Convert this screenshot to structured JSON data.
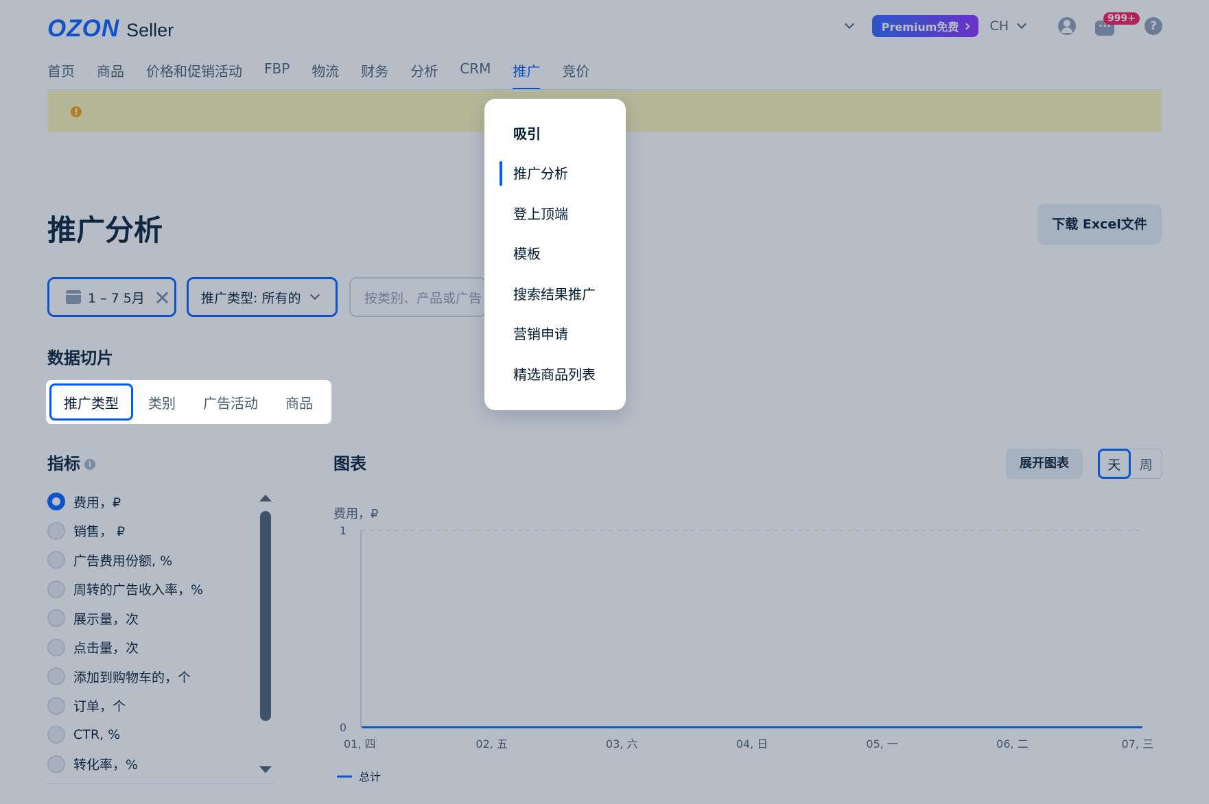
{
  "header": {
    "logo_main": "OZON",
    "logo_sub": "Seller",
    "premium_label": "Premium免费",
    "language": "CH",
    "notifications_badge": "999+",
    "help_label": "?"
  },
  "nav": {
    "items": [
      "首页",
      "商品",
      "价格和促销活动",
      "FBP",
      "物流",
      "财务",
      "分析",
      "CRM",
      "推广",
      "竞价"
    ],
    "active": "推广"
  },
  "banner": {
    "icon": "warning-icon"
  },
  "page": {
    "title": "推广分析",
    "excel_button": "下载 Excel文件"
  },
  "filters": {
    "date_range": "1 – 7 5月",
    "promotion_type": "推广类型: 所有的",
    "search_placeholder": "按类别、产品或广告"
  },
  "slice": {
    "heading": "数据切片",
    "tabs": [
      "推广类型",
      "类别",
      "广告活动",
      "商品"
    ],
    "active_tab": "推广类型"
  },
  "metrics": {
    "heading": "指标",
    "info_label": "i",
    "items": [
      "费用，₽",
      "销售， ₽",
      "广告费用份额, %",
      "周转的广告收入率，%",
      "展示量，次",
      "点击量，次",
      "添加到购物车的，个",
      "订单，个",
      "CTR, %",
      "转化率，%"
    ],
    "selected": "费用，₽"
  },
  "chart_section": {
    "heading": "图表",
    "expand_button": "展开图表",
    "granularity": [
      "天",
      "周"
    ],
    "active_granularity": "天"
  },
  "chart_data": {
    "type": "line",
    "ylabel": "费用，₽",
    "ylim": [
      0,
      1
    ],
    "yticks": [
      "1",
      "0"
    ],
    "categories": [
      "01, 四",
      "02, 五",
      "03, 六",
      "04, 日",
      "05, 一",
      "06, 二",
      "07, 三"
    ],
    "series": [
      {
        "name": "总计",
        "values": [
          0,
          0,
          0,
          0,
          0,
          0,
          0
        ],
        "color": "#005bff"
      }
    ],
    "grid": true,
    "legend": "bottom-left"
  },
  "dropdown_menu": {
    "items": [
      "吸引",
      "推广分析",
      "登上顶端",
      "模板",
      "搜索结果推广",
      "营销申请",
      "精选商品列表"
    ],
    "header_item": "吸引",
    "active_item": "推广分析"
  },
  "colors": {
    "accent": "#005bff",
    "warning": "#f5a200",
    "badge": "#f91155",
    "banner_bg": "#fff4b8"
  }
}
